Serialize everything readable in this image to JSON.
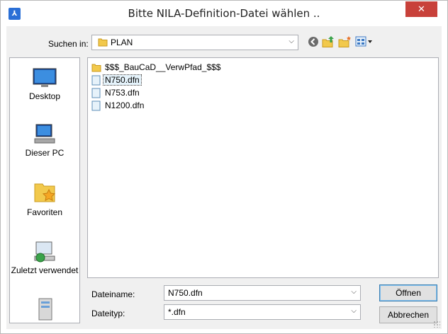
{
  "window": {
    "title": "Bitte NILA-Definition-Datei wählen ..",
    "app_icon_glyph": "⅄",
    "close_glyph": "✕"
  },
  "lookin": {
    "label": "Suchen in:",
    "value": "PLAN"
  },
  "places": [
    {
      "label": "Desktop"
    },
    {
      "label": "Dieser PC"
    },
    {
      "label": "Favoriten"
    },
    {
      "label": "Zuletzt verwendet"
    }
  ],
  "files": [
    {
      "name": "$$$_BauCaD__VerwPfad_$$$",
      "kind": "folder",
      "selected": false
    },
    {
      "name": "N750.dfn",
      "kind": "file",
      "selected": true
    },
    {
      "name": "N753.dfn",
      "kind": "file",
      "selected": false
    },
    {
      "name": "N1200.dfn",
      "kind": "file",
      "selected": false
    }
  ],
  "filename": {
    "label": "Dateiname:",
    "value": "N750.dfn"
  },
  "filetype": {
    "label": "Dateityp:",
    "value": "*.dfn"
  },
  "buttons": {
    "open": "Öffnen",
    "cancel": "Abbrechen"
  },
  "colors": {
    "close_red": "#c8413a",
    "selection": "#e5f3fb",
    "folder_yellow": "#f2c94c"
  }
}
